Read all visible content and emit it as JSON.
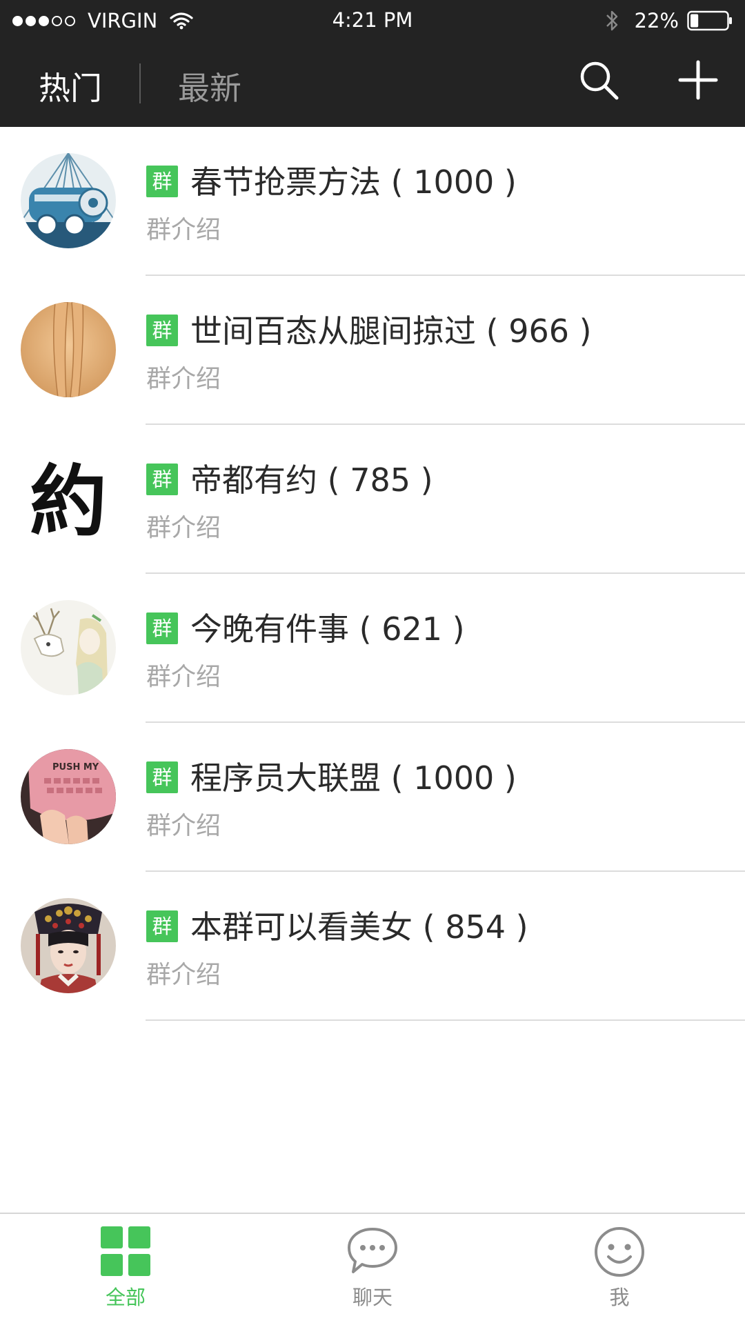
{
  "status_bar": {
    "carrier": "VIRGIN",
    "time": "4:21 PM",
    "battery_percent": "22%",
    "battery_level": 0.22,
    "signal_bars_filled": 3,
    "signal_bars_total": 5
  },
  "nav": {
    "tab_hot": "热门",
    "tab_new": "最新",
    "search_icon": "search-icon",
    "add_icon": "plus-icon"
  },
  "groups": [
    {
      "badge": "群",
      "title": "春节抢票方法 ( 1000 )",
      "intro": "群介绍",
      "avatar": "train"
    },
    {
      "badge": "群",
      "title": "世间百态从腿间掠过 ( 966 )",
      "intro": "群介绍",
      "avatar": "legs"
    },
    {
      "badge": "群",
      "title": "帝都有约 ( 785 )",
      "intro": "群介绍",
      "avatar": "calligraphy",
      "avatar_text": "約"
    },
    {
      "badge": "群",
      "title": "今晚有件事 ( 621 )",
      "intro": "群介绍",
      "avatar": "deer-illustration"
    },
    {
      "badge": "群",
      "title": "程序员大联盟 ( 1000 )",
      "intro": "群介绍",
      "avatar": "keyboard",
      "avatar_text": "PUSH MY"
    },
    {
      "badge": "群",
      "title": "本群可以看美女 ( 854 )",
      "intro": "群介绍",
      "avatar": "empress"
    }
  ],
  "tabbar": {
    "all_label": "全部",
    "chat_label": "聊天",
    "me_label": "我",
    "accent": "#46c55a"
  },
  "colors": {
    "header_bg": "#232323",
    "badge_green": "#46c55a",
    "intro_gray": "#a8a8a8"
  }
}
